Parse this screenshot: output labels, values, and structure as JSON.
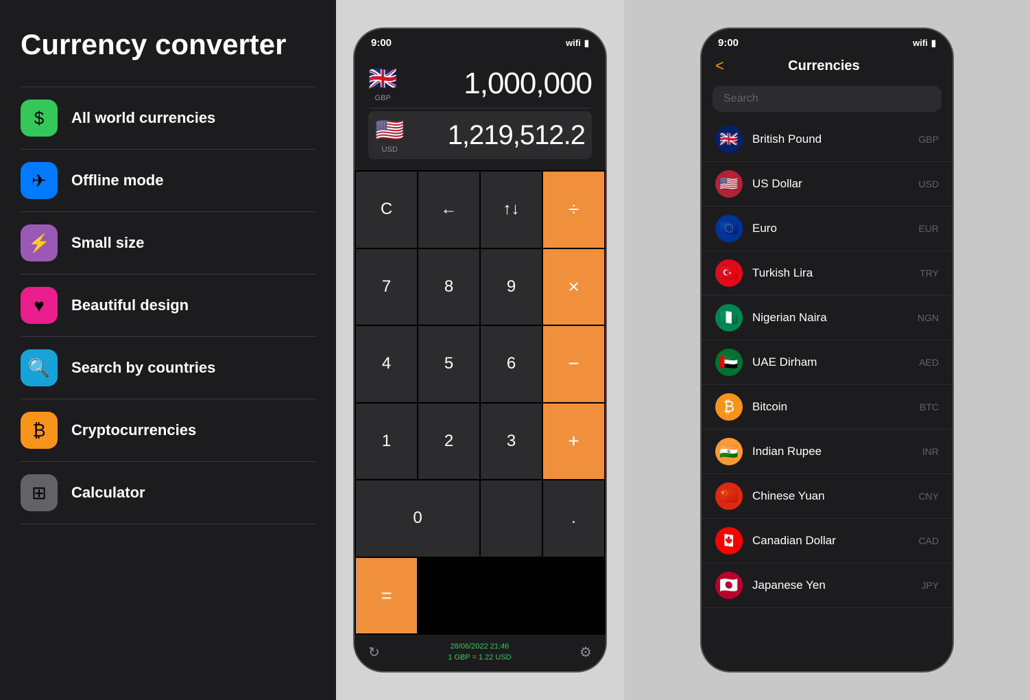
{
  "leftPanel": {
    "title": "Currency converter",
    "features": [
      {
        "id": "all-currencies",
        "label": "All world currencies",
        "iconClass": "icon-green",
        "icon": "$"
      },
      {
        "id": "offline-mode",
        "label": "Offline mode",
        "iconClass": "icon-blue",
        "icon": "✈"
      },
      {
        "id": "small-size",
        "label": "Small size",
        "iconClass": "icon-purple",
        "icon": "⚡"
      },
      {
        "id": "beautiful-design",
        "label": "Beautiful design",
        "iconClass": "icon-pink",
        "icon": "♥"
      },
      {
        "id": "search-countries",
        "label": "Search by countries",
        "iconClass": "icon-cyan",
        "icon": "🔍"
      },
      {
        "id": "crypto",
        "label": "Cryptocurrencies",
        "iconClass": "icon-orange",
        "icon": "₿"
      },
      {
        "id": "calculator",
        "label": "Calculator",
        "iconClass": "icon-gray",
        "icon": "⊞"
      }
    ]
  },
  "middlePhone": {
    "statusTime": "9:00",
    "fromCurrency": {
      "flag": "🇬🇧",
      "code": "GBP",
      "value": "1,000,000"
    },
    "toCurrency": {
      "flag": "🇺🇸",
      "code": "USD",
      "value": "1,219,512.2"
    },
    "calcButtons": [
      {
        "label": "C",
        "type": "dark"
      },
      {
        "label": "←",
        "type": "dark"
      },
      {
        "label": "↑↓",
        "type": "dark"
      },
      {
        "label": "÷",
        "type": "orange"
      },
      {
        "label": "7",
        "type": "dark"
      },
      {
        "label": "8",
        "type": "dark"
      },
      {
        "label": "9",
        "type": "dark"
      },
      {
        "label": "×",
        "type": "orange"
      },
      {
        "label": "4",
        "type": "dark"
      },
      {
        "label": "5",
        "type": "dark"
      },
      {
        "label": "6",
        "type": "dark"
      },
      {
        "label": "−",
        "type": "orange"
      },
      {
        "label": "1",
        "type": "dark"
      },
      {
        "label": "2",
        "type": "dark"
      },
      {
        "label": "3",
        "type": "dark"
      },
      {
        "label": "+",
        "type": "orange"
      },
      {
        "label": "0",
        "type": "dark",
        "wide": true
      },
      {
        "label": "",
        "type": "dark"
      },
      {
        "label": ".",
        "type": "dark"
      },
      {
        "label": "=",
        "type": "orange"
      }
    ],
    "bottomDate": "28/06/2022 21:46",
    "bottomRate": "1 GBP = 1.22 USD"
  },
  "rightPhone": {
    "statusTime": "9:00",
    "navTitle": "Currencies",
    "backLabel": "<",
    "searchPlaceholder": "Search",
    "currencies": [
      {
        "name": "British Pound",
        "code": "GBP",
        "flagEmoji": "🇬🇧",
        "flagBg": "#012169"
      },
      {
        "name": "US Dollar",
        "code": "USD",
        "flagEmoji": "🇺🇸",
        "flagBg": "#B22234"
      },
      {
        "name": "Euro",
        "code": "EUR",
        "flagEmoji": "🇪🇺",
        "flagBg": "#003399"
      },
      {
        "name": "Turkish Lira",
        "code": "TRY",
        "flagEmoji": "🇹🇷",
        "flagBg": "#E30A17"
      },
      {
        "name": "Nigerian Naira",
        "code": "NGN",
        "flagEmoji": "🇳🇬",
        "flagBg": "#008751"
      },
      {
        "name": "UAE Dirham",
        "code": "AED",
        "flagEmoji": "🇦🇪",
        "flagBg": "#00732f"
      },
      {
        "name": "Bitcoin",
        "code": "BTC",
        "flagEmoji": "₿",
        "flagBg": "#f7931a"
      },
      {
        "name": "Indian Rupee",
        "code": "INR",
        "flagEmoji": "🇮🇳",
        "flagBg": "#FF9933"
      },
      {
        "name": "Chinese Yuan",
        "code": "CNY",
        "flagEmoji": "🇨🇳",
        "flagBg": "#DE2910"
      },
      {
        "name": "Canadian Dollar",
        "code": "CAD",
        "flagEmoji": "🇨🇦",
        "flagBg": "#FF0000"
      },
      {
        "name": "Japanese Yen",
        "code": "JPY",
        "flagEmoji": "🇯🇵",
        "flagBg": "#BC002D"
      }
    ]
  }
}
